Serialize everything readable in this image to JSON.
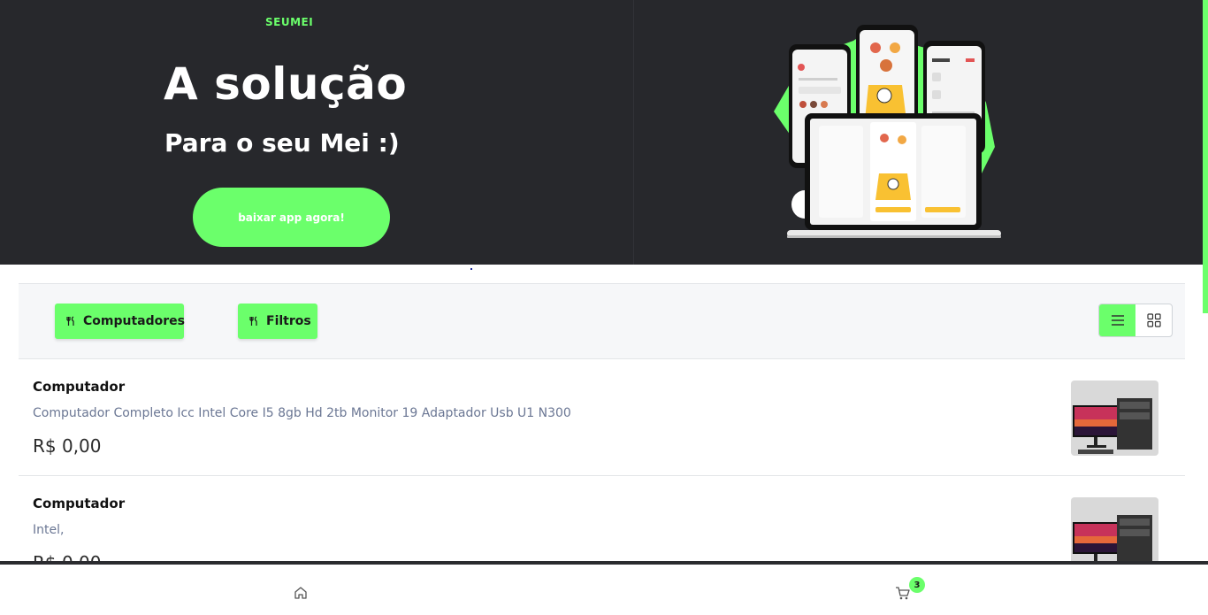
{
  "hero": {
    "brand": "SEUMEI",
    "title": "A solução",
    "subtitle": "Para o seu Mei :)",
    "cta_label": "baixar app agora!"
  },
  "toolbar": {
    "chips": [
      {
        "label": "Computadores",
        "icon": "utensils-icon"
      },
      {
        "label": "Filtros",
        "icon": "utensils-icon"
      }
    ],
    "view_modes": [
      "list",
      "grid"
    ],
    "active_view": "list"
  },
  "products": [
    {
      "name": "Computador",
      "description": "Computador Completo Icc Intel Core I5 8gb Hd 2tb Monitor 19 Adaptador Usb U1 N300",
      "price": "R$ 0,00"
    },
    {
      "name": "Computador",
      "description": "Intel,",
      "price": "R$ 0,00"
    }
  ],
  "bottom_nav": {
    "items": [
      "home-icon",
      "cart-icon"
    ],
    "cart_count": "3"
  },
  "colors": {
    "accent": "#6bff6b",
    "hero_bg": "#27282c",
    "toolbar_bg": "#f6f7f9"
  }
}
